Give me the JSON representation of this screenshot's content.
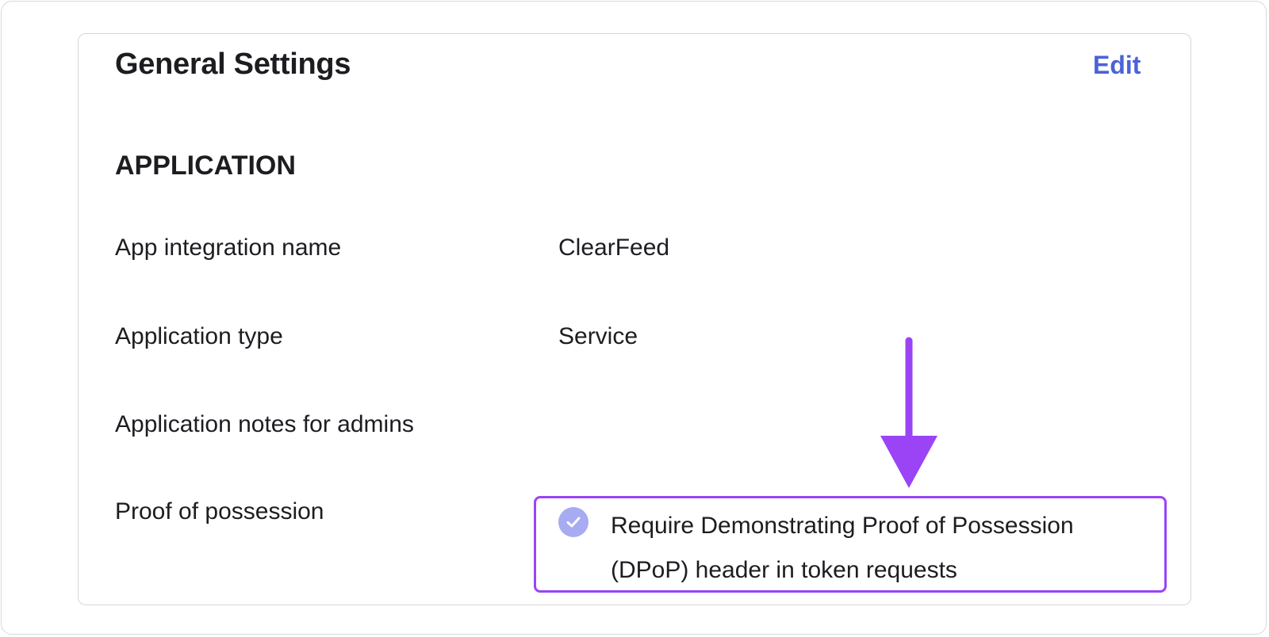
{
  "panel": {
    "title": "General Settings",
    "edit_label": "Edit"
  },
  "section": {
    "heading": "APPLICATION"
  },
  "rows": [
    {
      "label": "App integration name",
      "value": "ClearFeed"
    },
    {
      "label": "Application type",
      "value": "Service"
    },
    {
      "label": "Application notes for admins",
      "value": ""
    },
    {
      "label": "Proof of possession",
      "value": "Require Demonstrating Proof of Possession (DPoP) header in token requests"
    }
  ],
  "proof_of_possession": {
    "checked": true
  },
  "colors": {
    "link": "#4b62d8",
    "annotation": "#9a44f5",
    "checkbox": "#a6abf2"
  },
  "icons": {
    "checkbox": "check-circle-icon",
    "annotation": "arrow-down-icon"
  }
}
